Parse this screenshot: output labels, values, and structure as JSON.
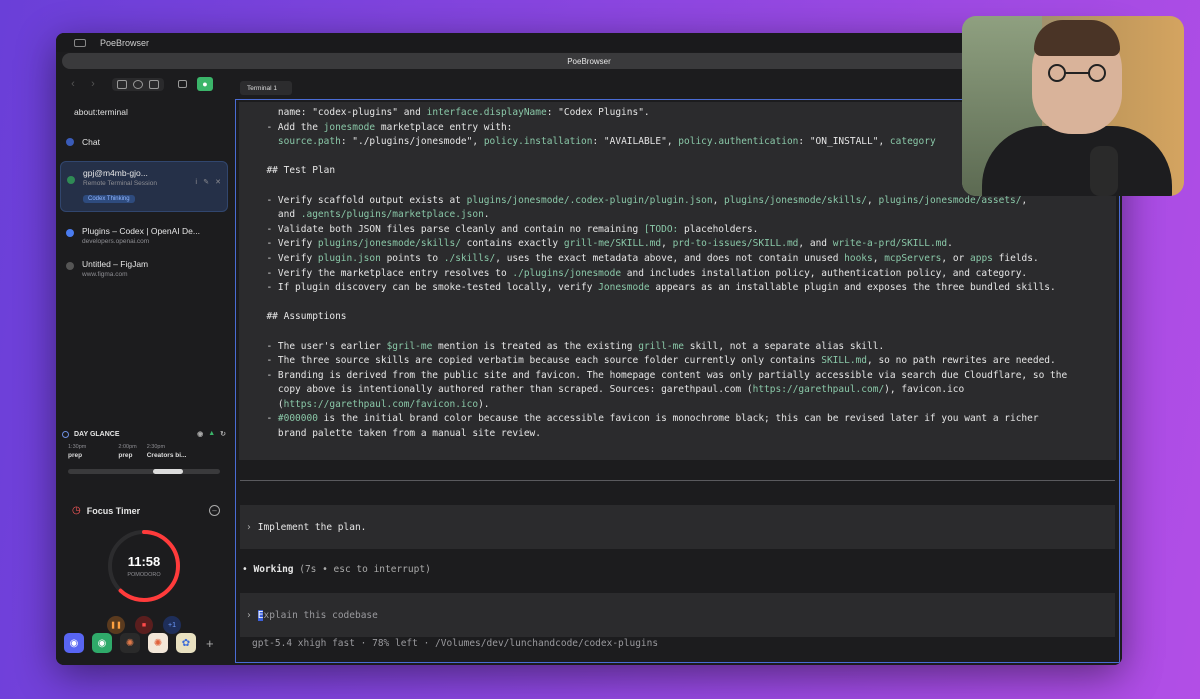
{
  "window": {
    "title": "PoeBrowser",
    "url_strip": "PoeBrowser"
  },
  "sidebar": {
    "address": "about:terminal",
    "tabs": [
      {
        "title": "Chat",
        "subtitle": ""
      },
      {
        "title": "gpj@m4mb-gjo...",
        "subtitle": "Remote Terminal Session",
        "badge": "Codex Thinking"
      },
      {
        "title": "Plugins – Codex | OpenAI De...",
        "subtitle": "developers.openai.com"
      },
      {
        "title": "Untitled – FigJam",
        "subtitle": "www.figma.com"
      }
    ],
    "glance": {
      "title": "DAY GLANCE",
      "events": [
        {
          "time": "1:30pm",
          "name": "prep"
        },
        {
          "time": "2:00pm",
          "name": "prep"
        },
        {
          "time": "2:30pm",
          "name": "Creators bi..."
        }
      ]
    },
    "focus": {
      "title": "Focus Timer",
      "time": "11:58",
      "mode": "POMODORO",
      "progress": 0.62,
      "plus_label": "+1"
    },
    "add_label": "+",
    "colors": {
      "accent": "#3b5fd9",
      "ring": "#ff3b3b",
      "green": "#3bb56a"
    }
  },
  "terminal": {
    "tab": "Terminal 1",
    "lines": [
      [
        {
          "t": "    name: \"codex-plugins\" and "
        },
        {
          "t": "interface.displayName",
          "h": 1
        },
        {
          "t": ": \"Codex Plugins\"."
        }
      ],
      [
        {
          "t": "  - Add the "
        },
        {
          "t": "jonesmode",
          "h": 1
        },
        {
          "t": " marketplace entry with:"
        }
      ],
      [
        {
          "t": "    "
        },
        {
          "t": "source.path",
          "h": 1
        },
        {
          "t": ": \"./plugins/jonesmode\", "
        },
        {
          "t": "policy.installation",
          "h": 1
        },
        {
          "t": ": \"AVAILABLE\", "
        },
        {
          "t": "policy.authentication",
          "h": 1
        },
        {
          "t": ": \"ON_INSTALL\", "
        },
        {
          "t": "category",
          "h": 1
        }
      ],
      [
        {
          "t": ""
        }
      ],
      [
        {
          "t": "  ## Test Plan"
        }
      ],
      [
        {
          "t": ""
        }
      ],
      [
        {
          "t": "  - Verify scaffold output exists at "
        },
        {
          "t": "plugins/jonesmode/.codex-plugin/plugin.json",
          "h": 1
        },
        {
          "t": ", "
        },
        {
          "t": "plugins/jonesmode/skills/",
          "h": 1
        },
        {
          "t": ", "
        },
        {
          "t": "plugins/jonesmode/assets/",
          "h": 1
        },
        {
          "t": ","
        }
      ],
      [
        {
          "t": "    and "
        },
        {
          "t": ".agents/plugins/marketplace.json",
          "h": 1
        },
        {
          "t": "."
        }
      ],
      [
        {
          "t": "  - Validate both JSON files parse cleanly and contain no remaining "
        },
        {
          "t": "[TODO:",
          "h": 1
        },
        {
          "t": " placeholders."
        }
      ],
      [
        {
          "t": "  - Verify "
        },
        {
          "t": "plugins/jonesmode/skills/",
          "h": 1
        },
        {
          "t": " contains exactly "
        },
        {
          "t": "grill-me/SKILL.md",
          "h": 1
        },
        {
          "t": ", "
        },
        {
          "t": "prd-to-issues/SKILL.md",
          "h": 1
        },
        {
          "t": ", and "
        },
        {
          "t": "write-a-prd/SKILL.md",
          "h": 1
        },
        {
          "t": "."
        }
      ],
      [
        {
          "t": "  - Verify "
        },
        {
          "t": "plugin.json",
          "h": 1
        },
        {
          "t": " points to "
        },
        {
          "t": "./skills/",
          "h": 1
        },
        {
          "t": ", uses the exact metadata above, and does not contain unused "
        },
        {
          "t": "hooks",
          "h": 1
        },
        {
          "t": ", "
        },
        {
          "t": "mcpServers",
          "h": 1
        },
        {
          "t": ", or "
        },
        {
          "t": "apps",
          "h": 1
        },
        {
          "t": " fields."
        }
      ],
      [
        {
          "t": "  - Verify the marketplace entry resolves to "
        },
        {
          "t": "./plugins/jonesmode",
          "h": 1
        },
        {
          "t": " and includes installation policy, authentication policy, and category."
        }
      ],
      [
        {
          "t": "  - If plugin discovery can be smoke-tested locally, verify "
        },
        {
          "t": "Jonesmode",
          "h": 1
        },
        {
          "t": " appears as an installable plugin and exposes the three bundled skills."
        }
      ],
      [
        {
          "t": ""
        }
      ],
      [
        {
          "t": "  ## Assumptions"
        }
      ],
      [
        {
          "t": ""
        }
      ],
      [
        {
          "t": "  - The user's earlier "
        },
        {
          "t": "$gril-me",
          "h": 1
        },
        {
          "t": " mention is treated as the existing "
        },
        {
          "t": "grill-me",
          "h": 1
        },
        {
          "t": " skill, not a separate alias skill."
        }
      ],
      [
        {
          "t": "  - The three source skills are copied verbatim because each source folder currently only contains "
        },
        {
          "t": "SKILL.md",
          "h": 1
        },
        {
          "t": ", so no path rewrites are needed."
        }
      ],
      [
        {
          "t": "  - Branding is derived from the public site and favicon. The homepage content was only partially accessible via search due Cloudflare, so the"
        }
      ],
      [
        {
          "t": "    copy above is intentionally authored rather than scraped. Sources: garethpaul.com ("
        },
        {
          "t": "https://garethpaul.com/",
          "h": 1
        },
        {
          "t": "), favicon.ico"
        }
      ],
      [
        {
          "t": "    ("
        },
        {
          "t": "https://garethpaul.com/favicon.ico",
          "h": 1
        },
        {
          "t": ")."
        }
      ],
      [
        {
          "t": "  - "
        },
        {
          "t": "#000000",
          "h": 1
        },
        {
          "t": " is the initial brand color because the accessible favicon is monochrome black; this can be revised later if you want a richer"
        }
      ],
      [
        {
          "t": "    brand palette taken from a manual site review."
        }
      ]
    ],
    "prompt1": "Implement the plan.",
    "working_label": "Working",
    "working_detail": " (7s • esc to interrupt)",
    "input_first": "E",
    "input_rest": "xplain this codebase",
    "status": "gpt-5.4 xhigh fast · 78% left · /Volumes/dev/lunchandcode/codex-plugins"
  }
}
